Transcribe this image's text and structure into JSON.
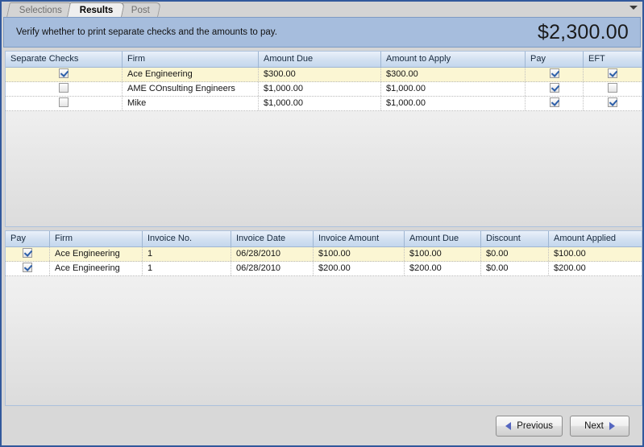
{
  "window": {
    "overflow_icon": "chevron-down-icon"
  },
  "tabs": [
    {
      "label": "Selections",
      "active": false
    },
    {
      "label": "Results",
      "active": true
    },
    {
      "label": "Post",
      "active": false
    }
  ],
  "banner": {
    "instruction": "Verify whether to print separate checks and the amounts to pay.",
    "total": "$2,300.00"
  },
  "checks_grid": {
    "columns": [
      "Separate Checks",
      "Firm",
      "Amount Due",
      "Amount to Apply",
      "Pay",
      "EFT"
    ],
    "rows": [
      {
        "separate_checks": true,
        "firm": "Ace Engineering",
        "amount_due": "$300.00",
        "amount_to_apply": "$300.00",
        "pay": true,
        "eft": true,
        "selected": true
      },
      {
        "separate_checks": false,
        "firm": "AME COnsulting Engineers",
        "amount_due": "$1,000.00",
        "amount_to_apply": "$1,000.00",
        "pay": true,
        "eft": false,
        "selected": false
      },
      {
        "separate_checks": false,
        "firm": "Mike",
        "amount_due": "$1,000.00",
        "amount_to_apply": "$1,000.00",
        "pay": true,
        "eft": true,
        "selected": false
      }
    ]
  },
  "invoices_grid": {
    "columns": [
      "Pay",
      "Firm",
      "Invoice No.",
      "Invoice Date",
      "Invoice Amount",
      "Amount Due",
      "Discount",
      "Amount Applied"
    ],
    "rows": [
      {
        "pay": true,
        "firm": "Ace Engineering",
        "invoice_no": "1",
        "invoice_date": "06/28/2010",
        "invoice_amount": "$100.00",
        "amount_due": "$100.00",
        "discount": "$0.00",
        "amount_applied": "$100.00",
        "selected": true
      },
      {
        "pay": true,
        "firm": "Ace Engineering",
        "invoice_no": "1",
        "invoice_date": "06/28/2010",
        "invoice_amount": "$200.00",
        "amount_due": "$200.00",
        "discount": "$0.00",
        "amount_applied": "$200.00",
        "selected": false
      }
    ]
  },
  "footer": {
    "previous_label": "Previous",
    "next_label": "Next"
  },
  "colors": {
    "banner_background": "#a6bddd",
    "window_border": "#31589c",
    "selected_row": "#fbf6d3",
    "header_gradient_top": "#eaf1fa",
    "header_gradient_bottom": "#c4d7ed",
    "checkmark": "#2d5fa8",
    "arrow": "#5566c0"
  }
}
